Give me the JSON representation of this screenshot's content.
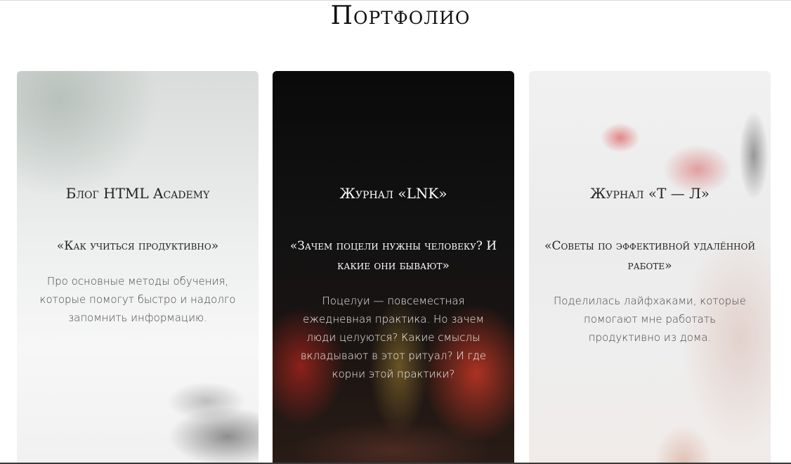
{
  "page": {
    "title": "Портфолио"
  },
  "cards": [
    {
      "title": "Блог HTML Academy",
      "subtitle": "«Как учиться продуктивно»",
      "text": "Про основные методы обучения, которые помогут быстро и надолго запомнить информацию."
    },
    {
      "title": "Журнал «LNK»",
      "subtitle": "«Зачем поцели нужны человеку? И какие они бывают»",
      "text": "Поцелуи — повсеместная ежедневная практика. Но зачем люди целуются? Какие смыслы вкладывают в этот ритуал? И где корни этой практики?"
    },
    {
      "title": "Журнал «Т — Л»",
      "subtitle": "«Советы по эффективной удалённой работе»",
      "text": "Поделилась лайфхаками, которые помогают мне работать продуктивно из дома."
    }
  ]
}
